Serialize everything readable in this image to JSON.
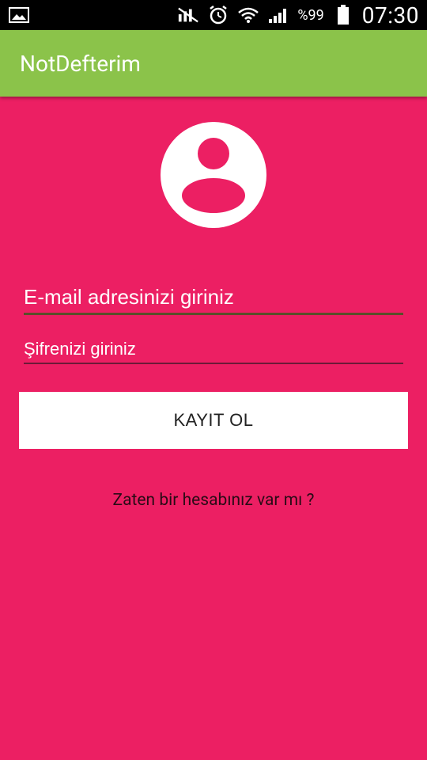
{
  "status_bar": {
    "battery_percent": "%99",
    "time": "07:30"
  },
  "app_bar": {
    "title": "NotDefterim"
  },
  "form": {
    "email_placeholder": "E-mail adresinizi giriniz",
    "password_placeholder": "Şifrenizi giriniz",
    "register_label": "KAYIT OL",
    "login_link": "Zaten bir hesabınız var mı ?"
  },
  "colors": {
    "background": "#EC1F63",
    "app_bar": "#8BC34A",
    "status_bar": "#000000"
  }
}
